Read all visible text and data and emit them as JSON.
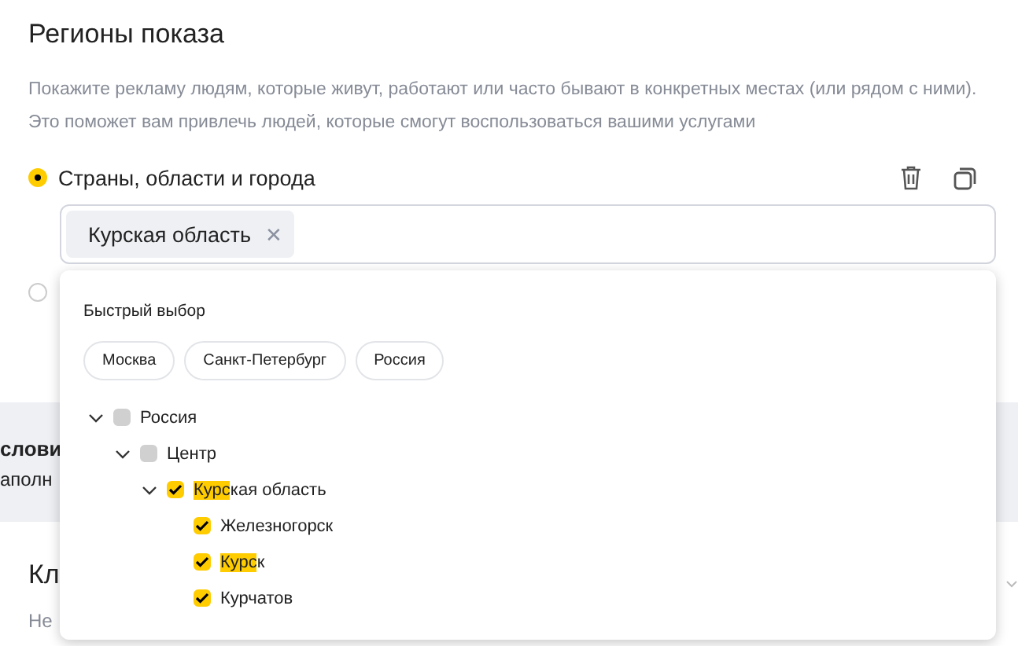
{
  "section": {
    "title": "Регионы показа",
    "description": [
      "Покажите рекламу людям, которые живут, работают или часто бывают в конкретных местах (или рядом с ними).",
      "Это поможет вам привлечь людей, которые смогут воспользоваться вашими услугами"
    ]
  },
  "options": [
    {
      "label": "Страны, области и города",
      "selected": true,
      "tags": [
        {
          "label": "Курская область",
          "remove": "✕"
        }
      ]
    },
    {
      "selected": false
    }
  ],
  "band": {
    "title": "слови",
    "text": "аполн"
  },
  "keywords": {
    "title": "Кл",
    "value": "Не"
  },
  "popup": {
    "quick_title": "Быстрый выбор",
    "quick": [
      "Москва",
      "Санкт-Петербург",
      "Россия"
    ],
    "tree": [
      {
        "label_parts": [
          {
            "text": "Россия",
            "highlighted": false
          }
        ],
        "checked": false,
        "expanded": true,
        "children": [
          {
            "label_parts": [
              {
                "text": "Центр",
                "highlighted": false
              }
            ],
            "checked": false,
            "expanded": true,
            "children": [
              {
                "label_parts": [
                  {
                    "text": "Курс",
                    "highlighted": true
                  },
                  {
                    "text": "кая область",
                    "highlighted": false
                  }
                ],
                "checked": true,
                "expanded": true,
                "children": [
                  {
                    "label_parts": [
                      {
                        "text": "Железногорск",
                        "highlighted": false
                      }
                    ],
                    "checked": true
                  },
                  {
                    "label_parts": [
                      {
                        "text": "Курс",
                        "highlighted": true
                      },
                      {
                        "text": "к",
                        "highlighted": false
                      }
                    ],
                    "checked": true
                  },
                  {
                    "label_parts": [
                      {
                        "text": "Курчатов",
                        "highlighted": false
                      }
                    ],
                    "checked": true
                  }
                ]
              }
            ]
          }
        ]
      }
    ]
  }
}
